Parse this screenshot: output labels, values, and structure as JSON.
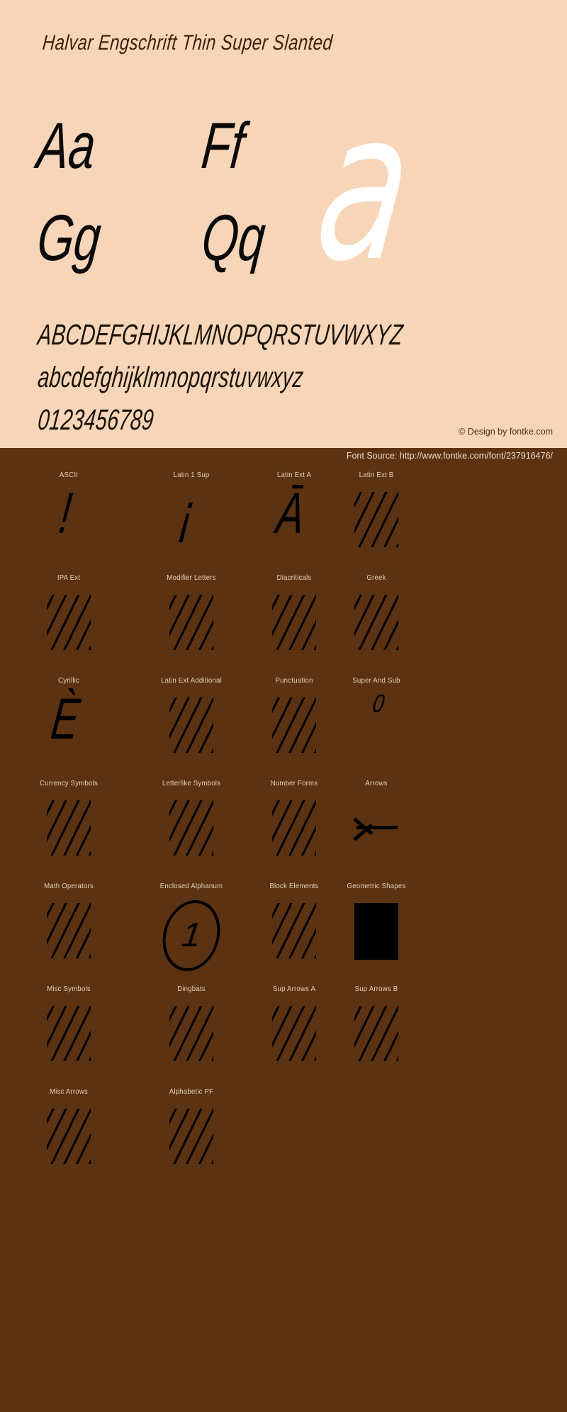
{
  "specimen": {
    "title": "Halvar Engschrift Thin Super Slanted",
    "watermark_glyph": "a",
    "pairs": [
      "Aa",
      "Ff",
      "Gg",
      "Qq"
    ],
    "alphabet_uppercase": "ABCDEFGHIJKLMNOPQRSTUVWXYZ",
    "alphabet_lowercase": "abcdefghijklmnopqrstuvwxyz",
    "digits": "0123456789",
    "copyright": "© Design by fontke.com",
    "colors": {
      "panel_background": "#f6d5b8",
      "panel_text": "#1a1208",
      "watermark": "#ffffff",
      "page_background": "#5c3312",
      "block_label": "#e4cfb9",
      "glyph": "#000000"
    }
  },
  "source_bar": {
    "text": "Font Source: http://www.fontke.com/font/237916476/"
  },
  "blocks": {
    "rows": [
      [
        {
          "label": "ASCII",
          "glyph": "!",
          "render": "glyph"
        },
        {
          "label": "Latin 1 Sup",
          "glyph": "¡",
          "render": "glyph"
        },
        {
          "label": "Latin Ext A",
          "glyph": "Ā",
          "render": "glyph"
        },
        {
          "label": "Latin Ext B",
          "glyph": "",
          "render": "hatch"
        }
      ],
      [
        {
          "label": "IPA Ext",
          "glyph": "",
          "render": "hatch"
        },
        {
          "label": "Modifier Letters",
          "glyph": "",
          "render": "hatch"
        },
        {
          "label": "Diacriticals",
          "glyph": "",
          "render": "hatch"
        },
        {
          "label": "Greek",
          "glyph": "",
          "render": "hatch"
        }
      ],
      [
        {
          "label": "Cyrillic",
          "glyph": "Ѐ",
          "render": "glyph"
        },
        {
          "label": "Latin Ext Additional",
          "glyph": "",
          "render": "hatch"
        },
        {
          "label": "Punctuation",
          "glyph": "",
          "render": "hatch"
        },
        {
          "label": "Super And Sub",
          "glyph": "⁰",
          "render": "glyph-small"
        }
      ],
      [
        {
          "label": "Currency Symbols",
          "glyph": "",
          "render": "hatch"
        },
        {
          "label": "Letterlike Symbols",
          "glyph": "",
          "render": "hatch"
        },
        {
          "label": "Number Forms",
          "glyph": "",
          "render": "hatch"
        },
        {
          "label": "Arrows",
          "glyph": "←",
          "render": "arrow-left"
        }
      ],
      [
        {
          "label": "Math Operators",
          "glyph": "",
          "render": "hatch"
        },
        {
          "label": "Enclosed Alphanum",
          "glyph": "①",
          "render": "circled"
        },
        {
          "label": "Block Elements",
          "glyph": "",
          "render": "hatch"
        },
        {
          "label": "Geometric Shapes",
          "glyph": "■",
          "render": "solid-square"
        }
      ],
      [
        {
          "label": "Misc Symbols",
          "glyph": "",
          "render": "hatch"
        },
        {
          "label": "Dingbats",
          "glyph": "",
          "render": "hatch"
        },
        {
          "label": "Sup Arrows A",
          "glyph": "",
          "render": "hatch"
        },
        {
          "label": "Sup Arrows B",
          "glyph": "",
          "render": "hatch"
        }
      ],
      [
        {
          "label": "Misc Arrows",
          "glyph": "",
          "render": "hatch"
        },
        {
          "label": "Alphabetic PF",
          "glyph": "",
          "render": "hatch"
        }
      ]
    ],
    "circled_digit": "1"
  }
}
